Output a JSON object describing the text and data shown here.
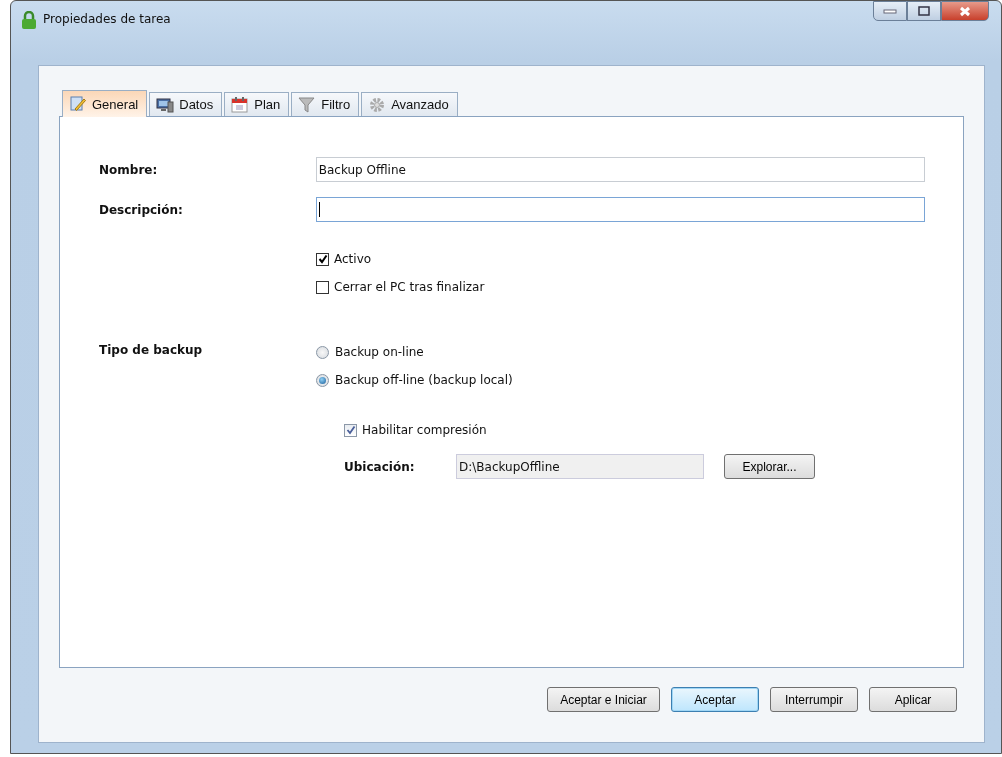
{
  "window": {
    "title": "Propiedades de tarea"
  },
  "tabs": [
    {
      "label": "General",
      "selected": true
    },
    {
      "label": "Datos",
      "selected": false
    },
    {
      "label": "Plan",
      "selected": false
    },
    {
      "label": "Filtro",
      "selected": false
    },
    {
      "label": "Avanzado",
      "selected": false
    }
  ],
  "fields": [
    {
      "label": "Nombre:",
      "value": "Backup Offline",
      "focused": false
    },
    {
      "label": "Descripción:",
      "focused": true
    }
  ],
  "checkboxes": [
    {
      "label": "Activo",
      "checked": true
    },
    {
      "label": "Cerrar el PC tras finalizar",
      "checked": false
    }
  ],
  "backup_type": {
    "label": "Tipo de backup",
    "options": [
      {
        "label": "Backup on-line",
        "selected": false
      },
      {
        "label": "Backup off-line (backup local)",
        "selected": true
      }
    ]
  },
  "compression": {
    "label": "Habilitar compresión",
    "checked": true
  },
  "location": {
    "label": "Ubicación:",
    "value": "D:\\BackupOffline",
    "button": "Explorar..."
  },
  "buttons": [
    {
      "label": "Aceptar e Iniciar",
      "default": false
    },
    {
      "label": "Aceptar",
      "default": true
    },
    {
      "label": "Interrumpir",
      "default": false
    },
    {
      "label": "Aplicar",
      "default": false
    }
  ]
}
